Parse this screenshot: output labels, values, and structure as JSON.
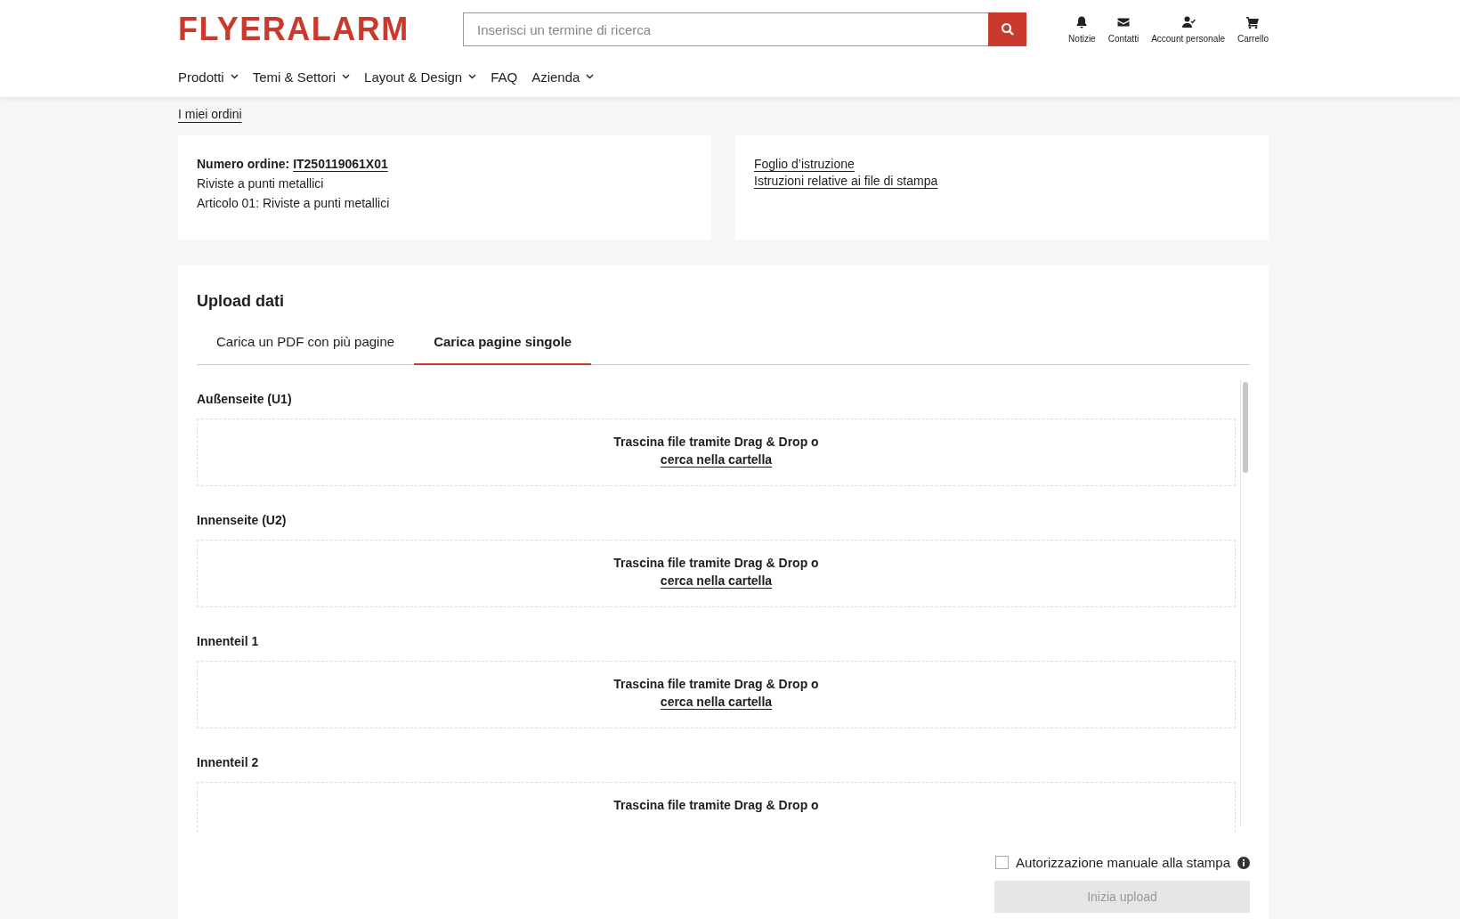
{
  "header": {
    "logo": "FLYERALARM",
    "search": {
      "placeholder": "Inserisci un termine di ricerca"
    },
    "actions": [
      {
        "kind": "bell",
        "label": "Notizie"
      },
      {
        "kind": "mail",
        "label": "Contatti"
      },
      {
        "kind": "user",
        "label": "Account personale"
      },
      {
        "kind": "cart",
        "label": "Carrello"
      }
    ]
  },
  "nav": [
    {
      "label": "Prodotti",
      "dropdown": true
    },
    {
      "label": "Temi & Settori",
      "dropdown": true
    },
    {
      "label": "Layout & Design",
      "dropdown": true
    },
    {
      "label": "FAQ",
      "dropdown": false
    },
    {
      "label": "Azienda",
      "dropdown": true
    }
  ],
  "breadcrumb": "I miei ordini",
  "order": {
    "number_label": "Numero ordine:",
    "number": "IT250119061X01",
    "lines": [
      "Riviste a punti metallici",
      "Articolo 01: Riviste a punti metallici"
    ]
  },
  "documents": [
    "Foglio d’istruzione",
    "Istruzioni relative ai file di stampa"
  ],
  "upload": {
    "title": "Upload dati",
    "tabs": [
      {
        "label": "Carica un PDF con più pagine",
        "selected": false
      },
      {
        "label": "Carica pagine singole",
        "selected": true
      }
    ],
    "sections": [
      {
        "label": "Außenseite (U1)",
        "drop_text": "Trascina file tramite Drag & Drop o",
        "browse_link": "cerca nella cartella"
      },
      {
        "label": "Innenseite (U2)",
        "drop_text": "Trascina file tramite Drag & Drop o",
        "browse_link": "cerca nella cartella"
      },
      {
        "label": "Innenteil 1",
        "drop_text": "Trascina file tramite Drag & Drop o",
        "browse_link": "cerca nella cartella"
      },
      {
        "label": "Innenteil 2",
        "drop_text": "Trascina file tramite Drag & Drop o"
      }
    ],
    "manual_approval": {
      "label": "Autorizzazione manuale alla stampa",
      "checked": false
    },
    "start_button": {
      "label": "Inizia upload",
      "disabled": true
    }
  }
}
